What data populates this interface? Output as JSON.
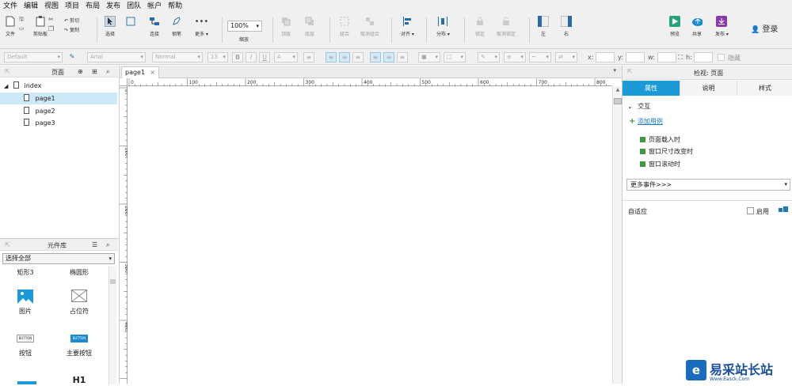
{
  "menu": [
    "文件",
    "编辑",
    "视图",
    "项目",
    "布局",
    "发布",
    "团队",
    "帐户",
    "帮助"
  ],
  "toolbar": {
    "file": "文件",
    "clipboard": "剪贴板",
    "cut": "剪切",
    "copy": "复制",
    "select": "选择",
    "connect": "连接",
    "pen": "钢笔",
    "more": "更多 ▾",
    "zoom_value": "100%",
    "zoom_label": "缩放",
    "top": "顶层",
    "bottom": "底层",
    "group": "组合",
    "ungroup": "取消组合",
    "align": "对齐 ▾",
    "distribute": "分布 ▾",
    "lock": "锁定",
    "unlock": "取消锁定",
    "left": "左",
    "right": "右",
    "preview": "预览",
    "share": "共享",
    "publish": "发布 ▾",
    "login": "登录"
  },
  "format": {
    "style": "Default",
    "font": "Arial",
    "weight": "Normal",
    "size": "13",
    "x_label": "x:",
    "y_label": "y:",
    "w_label": "w:",
    "h_label": "h:",
    "hidden": "隐藏"
  },
  "pages_panel": {
    "title": "页面",
    "pages": [
      "index",
      "page1",
      "page2",
      "page3"
    ],
    "selected": "page1"
  },
  "library": {
    "title": "元件库",
    "select_value": "选择全部",
    "items": [
      "矩形3",
      "椭圆形",
      "图片",
      "占位符",
      "按钮",
      "主要按钮",
      "H1"
    ],
    "button_text": "BUTTON"
  },
  "canvas": {
    "tab": "page1",
    "ruler_h": [
      "0",
      "100",
      "200",
      "300",
      "400",
      "500",
      "600",
      "700",
      "800"
    ],
    "ruler_v": [
      "0",
      "100",
      "200",
      "300",
      "400"
    ]
  },
  "inspector": {
    "title": "检视: 页面",
    "tabs": [
      "属性",
      "说明",
      "样式"
    ],
    "active_tab": "属性",
    "interaction": "交互",
    "add_case": "添加用例",
    "events": [
      "页面载入时",
      "窗口尺寸改变时",
      "窗口滚动时"
    ],
    "more_events": "更多事件>>>",
    "adaptive": "自适应",
    "enable": "启用"
  },
  "watermark": {
    "name": "易采站长站",
    "url": "Www.Easck.Com"
  },
  "colors": {
    "accent": "#1a9bd7",
    "menubar_bg": "#f0f0f0",
    "selected_row": "#cde8f6",
    "event_icon": "#3a9b3a"
  }
}
